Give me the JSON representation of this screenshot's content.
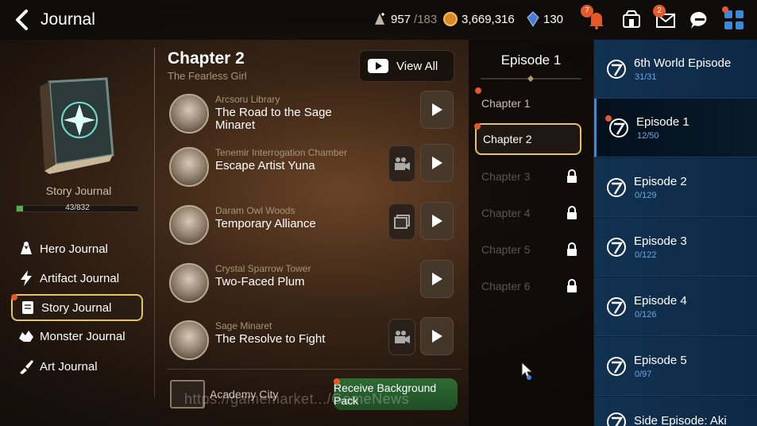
{
  "header": {
    "title": "Journal",
    "stamina": "957",
    "stamina_max": "/183",
    "gold": "3,669,316",
    "crystals": "130",
    "bell_badge": "7",
    "mail_badge": "2"
  },
  "left": {
    "book_label": "Story Journal",
    "progress_text": "43/832",
    "progress_fraction": 0.052,
    "nav": [
      {
        "label": "Hero Journal"
      },
      {
        "label": "Artifact Journal"
      },
      {
        "label": "Story Journal"
      },
      {
        "label": "Monster Journal"
      },
      {
        "label": "Art Journal"
      }
    ]
  },
  "chapter": {
    "title": "Chapter 2",
    "subtitle": "The Fearless Girl",
    "view_all": "View All",
    "episodes": [
      {
        "location": "Arcsoru Library",
        "name": "The Road to the Sage Minaret",
        "side": "none"
      },
      {
        "location": "Tenemir Interrogation Chamber",
        "name": "Escape Artist Yuna",
        "side": "camera"
      },
      {
        "location": "Daram Owl Woods",
        "name": "Temporary Alliance",
        "side": "picture"
      },
      {
        "location": "Crystal Sparrow Tower",
        "name": "Two-Faced Plum",
        "side": "none"
      },
      {
        "location": "Sage Minaret",
        "name": "The Resolve to Fight",
        "side": "camera"
      }
    ],
    "footer_location": "Academy City",
    "receive_button": "Receive Background Pack",
    "watermark": "https://gamemarket.../GameNews"
  },
  "chapters_col": {
    "header": "Episode 1",
    "items": [
      {
        "label": "Chapter 1",
        "state": "open"
      },
      {
        "label": "Chapter 2",
        "state": "selected"
      },
      {
        "label": "Chapter 3",
        "state": "locked"
      },
      {
        "label": "Chapter 4",
        "state": "locked"
      },
      {
        "label": "Chapter 5",
        "state": "locked"
      },
      {
        "label": "Chapter 6",
        "state": "locked"
      }
    ]
  },
  "episodes_col": {
    "items": [
      {
        "name": "6th World Episode",
        "count": "31/31"
      },
      {
        "name": "Episode 1",
        "count": "12/50"
      },
      {
        "name": "Episode 2",
        "count": "0/129"
      },
      {
        "name": "Episode 3",
        "count": "0/122"
      },
      {
        "name": "Episode 4",
        "count": "0/126"
      },
      {
        "name": "Episode 5",
        "count": "0/97"
      },
      {
        "name": "Side Episode: Aki",
        "count": ""
      }
    ]
  },
  "colors": {
    "accent_gold": "#e4c36b",
    "notify": "#e5582a",
    "progress": "#4fb54a",
    "episode_blue": "#0c2238"
  }
}
